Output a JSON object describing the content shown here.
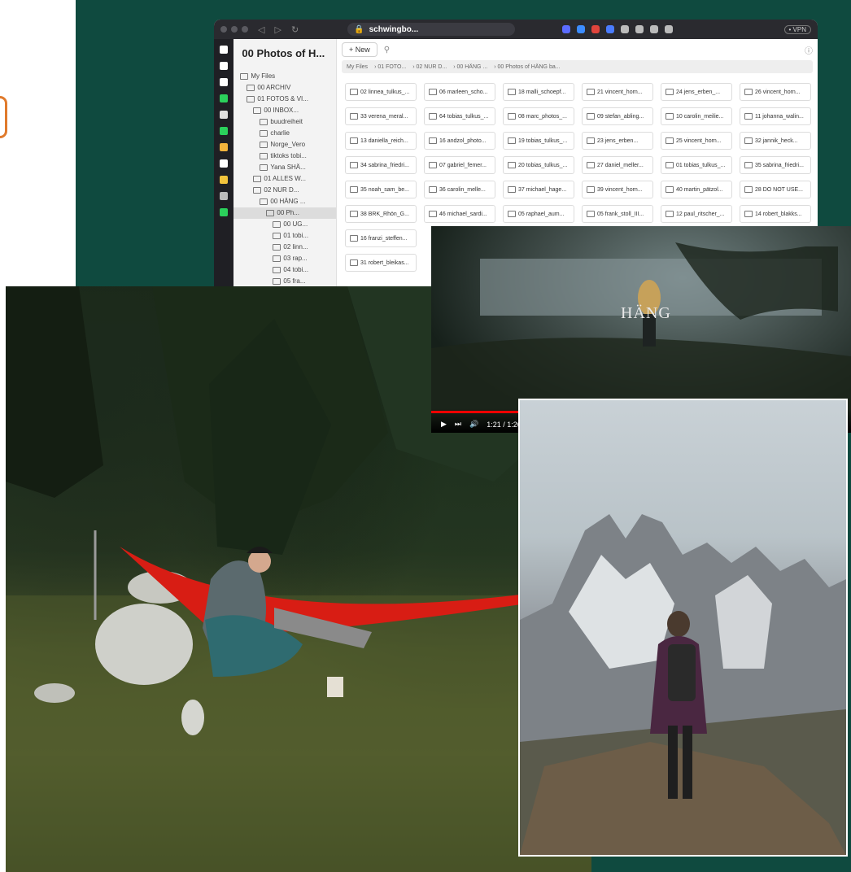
{
  "browser": {
    "address": "schwingbo...",
    "vpn": "• VPN",
    "extension_colors": [
      "#5b6cff",
      "#3c8cff",
      "#e0443c",
      "#4a7cff",
      "#bbbbbb",
      "#bbbbbb",
      "#bbbbbb",
      "#bbbbbb"
    ],
    "rail_colors": [
      "#ffffff",
      "#ffffff",
      "#ffffff",
      "#2bd05b",
      "#e0e0e0",
      "#2bd05b",
      "#f2b33c",
      "#ffffff",
      "#f2c33c",
      "#bbbbbb",
      "#2bd05b"
    ]
  },
  "files": {
    "title": "00 Photos of H...",
    "new_label": "+ New",
    "breadcrumbs": [
      "My Files",
      "01 FOTO...",
      "02 NUR D...",
      "00 HÄNG ...",
      "00 Photos of HÄNG ba..."
    ],
    "tree": [
      {
        "label": "My Files",
        "indent": 1,
        "active": false
      },
      {
        "label": "00 ARCHIV",
        "indent": 2,
        "active": false
      },
      {
        "label": "01 FOTOS & VI...",
        "indent": 2,
        "active": false
      },
      {
        "label": "00 INBOX...",
        "indent": 3,
        "active": false
      },
      {
        "label": "buudreiheit",
        "indent": 4,
        "active": false
      },
      {
        "label": "charlie",
        "indent": 4,
        "active": false
      },
      {
        "label": "Norge_Vero",
        "indent": 4,
        "active": false
      },
      {
        "label": "tiktoks tobi...",
        "indent": 4,
        "active": false
      },
      {
        "label": "Yana SHÄ...",
        "indent": 4,
        "active": false
      },
      {
        "label": "01 ALLES W...",
        "indent": 3,
        "active": false
      },
      {
        "label": "02 NUR D...",
        "indent": 3,
        "active": false
      },
      {
        "label": "00 HÄNG ...",
        "indent": 4,
        "active": false
      },
      {
        "label": "00 Ph...",
        "indent": 5,
        "active": true
      },
      {
        "label": "00 UG...",
        "indent": 6,
        "active": false
      },
      {
        "label": "01 tobi...",
        "indent": 6,
        "active": false
      },
      {
        "label": "02 linn...",
        "indent": 6,
        "active": false
      },
      {
        "label": "03 rap...",
        "indent": 6,
        "active": false
      },
      {
        "label": "04 tobi...",
        "indent": 6,
        "active": false
      },
      {
        "label": "05 fra...",
        "indent": 6,
        "active": false
      }
    ],
    "folders": [
      "02 linnea_tulkus_...",
      "06 marleen_scho...",
      "18 malli_schoepf...",
      "21 vincent_horn...",
      "24 jens_erben_...",
      "26 vincent_horn...",
      "33 verena_meral...",
      "64 tobias_tulkus_...",
      "08 marc_photos_...",
      "09 stefan_abling...",
      "10 carolin_meilie...",
      "11 johanna_walin...",
      "13 daniella_reich...",
      "16 andzol_photo...",
      "19 tobias_tulkus_...",
      "23 jens_erben...",
      "25 vincent_horn...",
      "32 jannik_heck...",
      "34 sabrina_friedri...",
      "07 gabriel_femer...",
      "20 tobias_tulkus_...",
      "27 daniel_meller...",
      "01 tobias_tulkus_...",
      "35 sabrina_friedri...",
      "35 noah_sam_be...",
      "36 carolin_melle...",
      "37 michael_hage...",
      "39 vincent_horn...",
      "40 martin_pätzol...",
      "28 DO NOT USE...",
      "38 BRK_Rhön_G...",
      "46 michael_sardi...",
      "05 raphael_aum...",
      "05 frank_stoll_III...",
      "12 paul_ritscher_...",
      "14 robert_blakks...",
      "16 franzi_steffen...",
      "",
      "",
      "",
      "",
      "",
      "31 robert_bleikas...",
      "",
      "",
      "",
      "",
      ""
    ]
  },
  "video": {
    "logo": "HÄNG",
    "time": "1:21 / 1:26"
  }
}
